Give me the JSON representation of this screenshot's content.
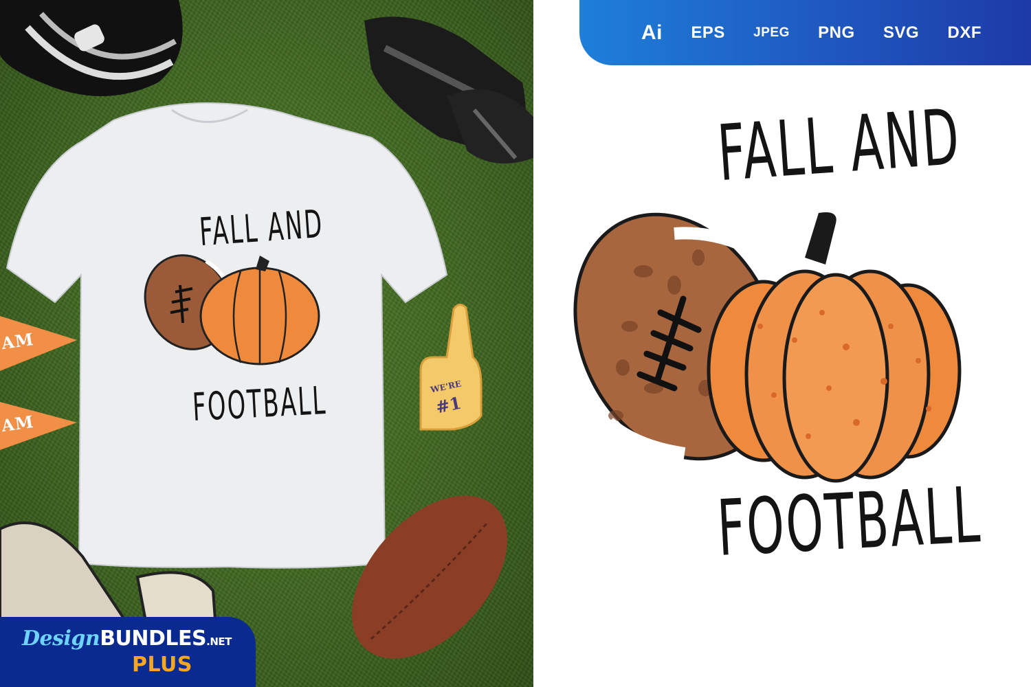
{
  "formats": [
    "Ai",
    "EPS",
    "JPEG",
    "PNG",
    "SVG",
    "DXF"
  ],
  "design": {
    "title_line1": "FALL AND",
    "title_line2": "FOOTBALL"
  },
  "mockup": {
    "shirt_line1": "FALL AND",
    "shirt_line2": "FOOTBALL",
    "foam_finger_line1": "WE'RE",
    "foam_finger_line2": "#1",
    "pennant1": "AM",
    "pennant2": "AM"
  },
  "brand": {
    "name_script": "Design",
    "name_bold": "BUNDLES",
    "name_suffix": ".NET",
    "tier": "PLUS"
  },
  "colors": {
    "format_bar_start": "#1e7fd8",
    "format_bar_end": "#1d3aa8",
    "pumpkin": "#ef8a3c",
    "football": "#9b5b38",
    "grass": "#3f6620",
    "brand_plus": "#f5a623"
  }
}
